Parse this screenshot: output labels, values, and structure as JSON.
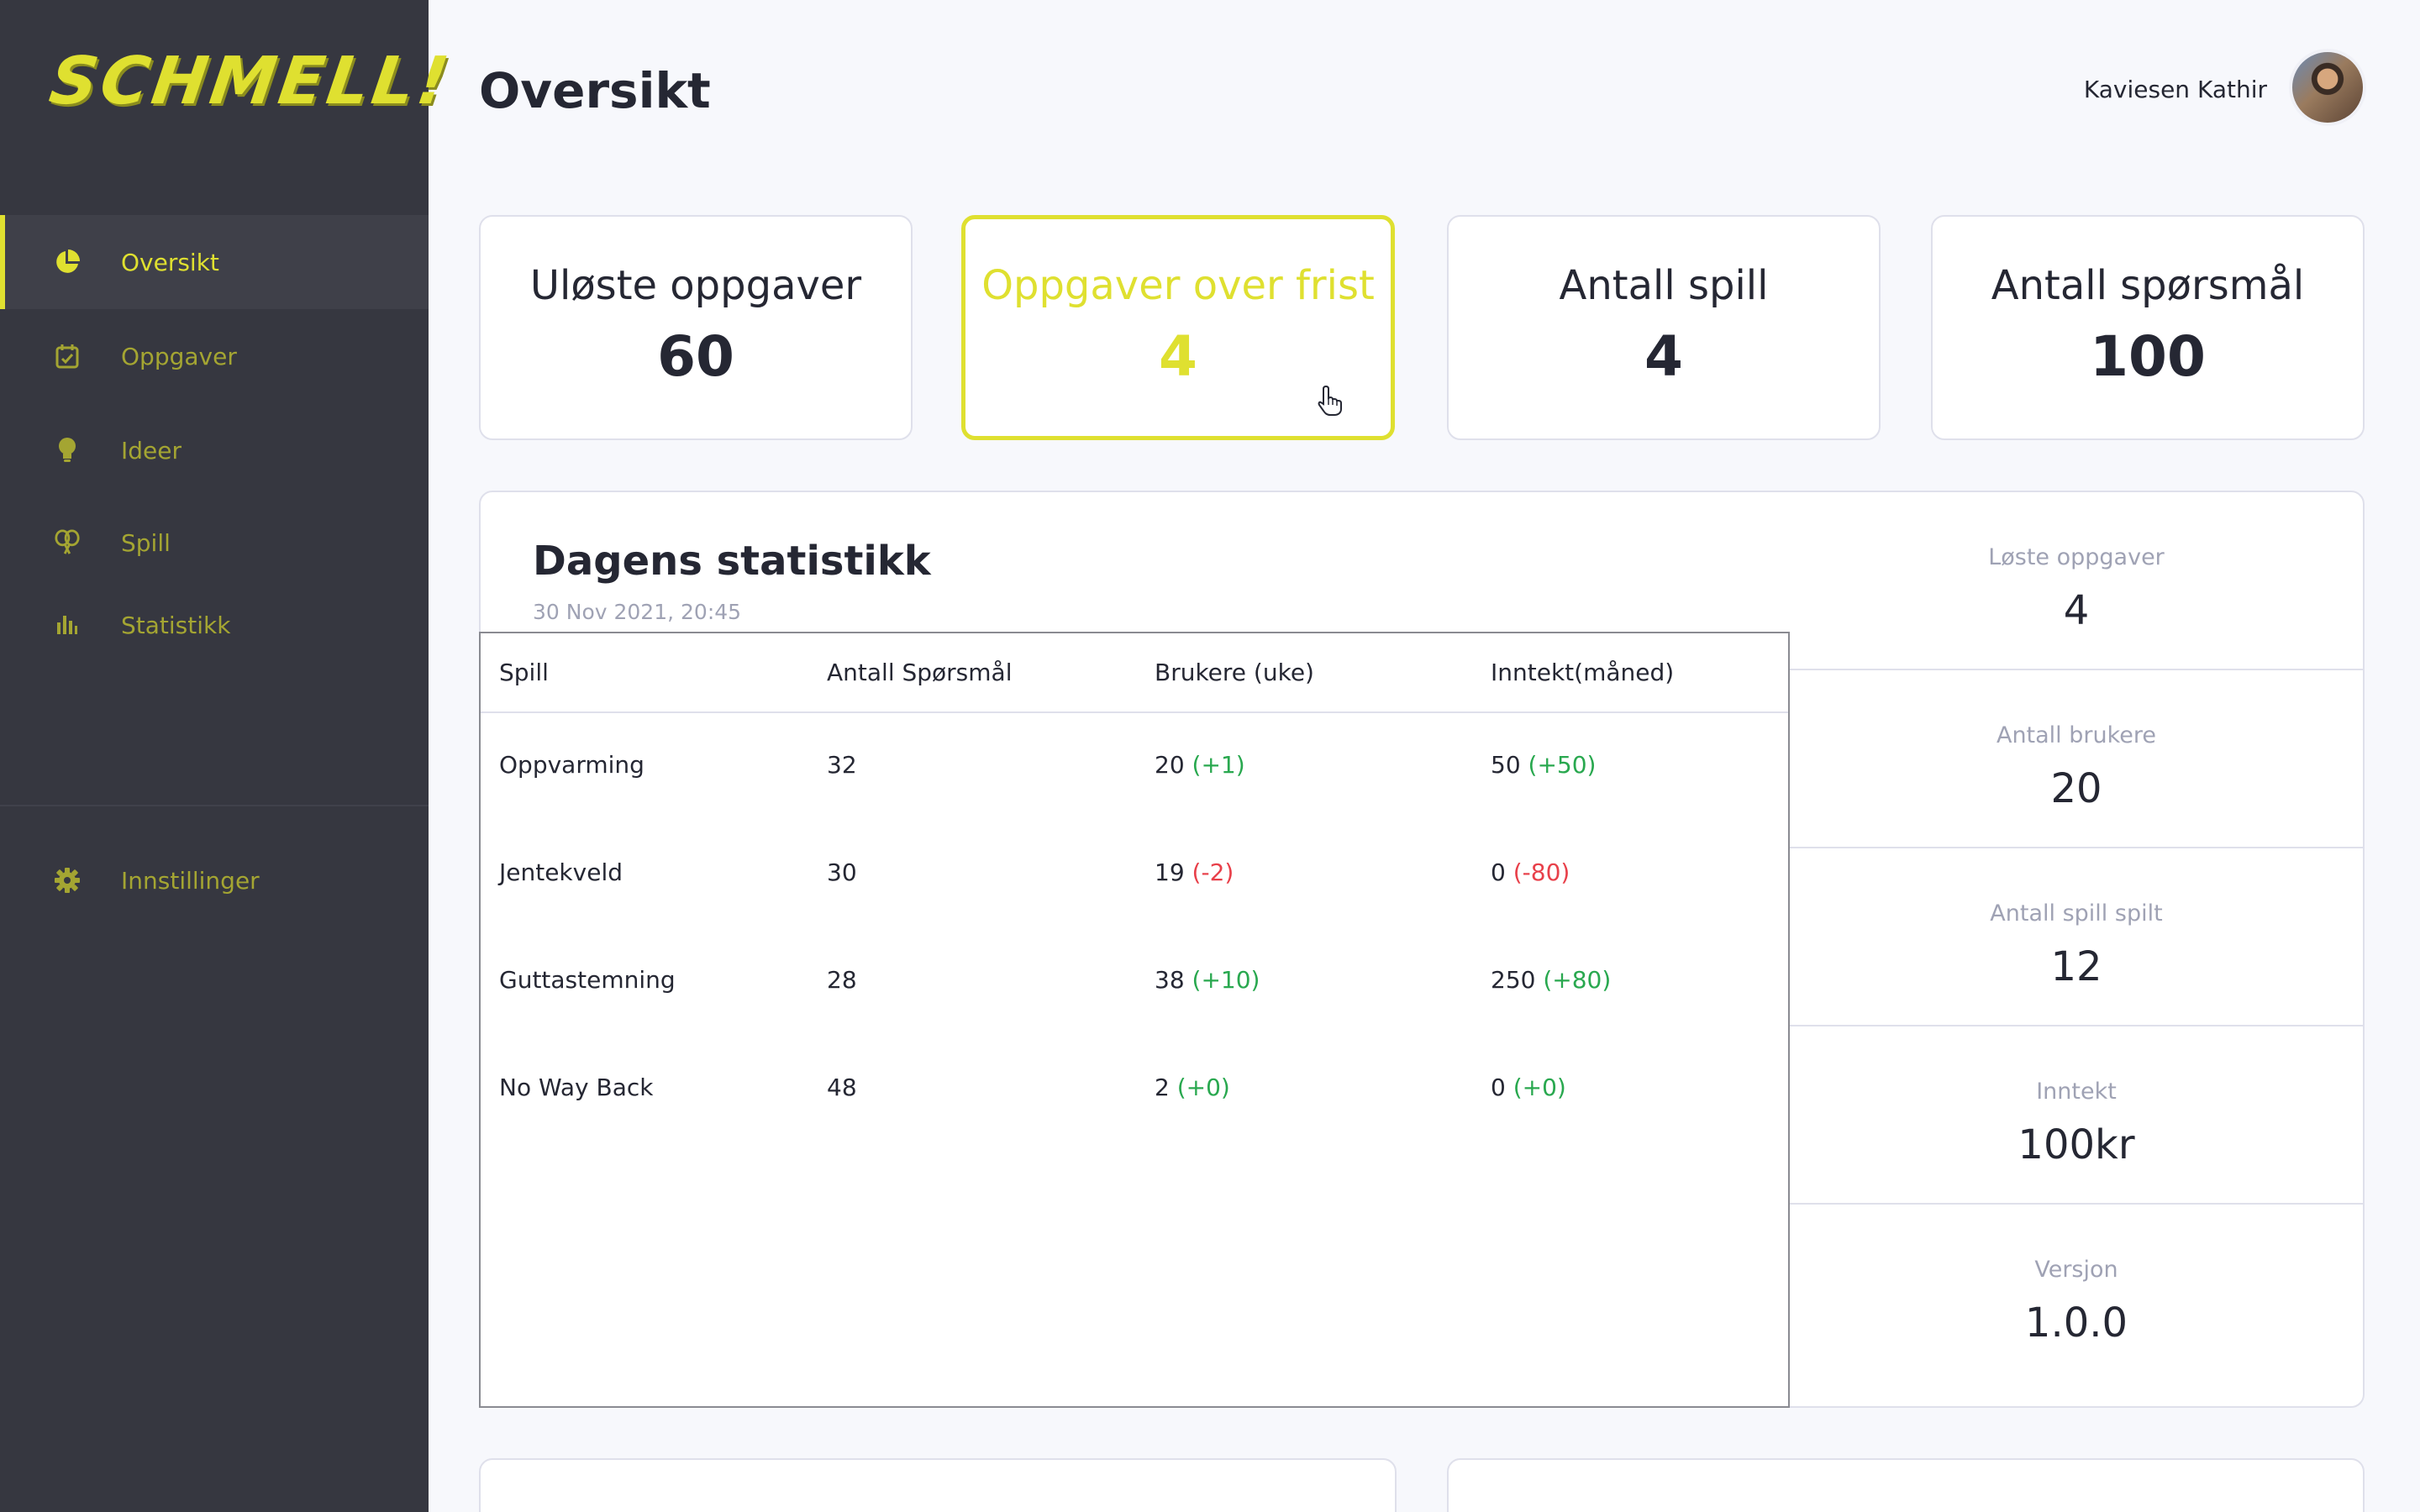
{
  "app": {
    "logo_text": "SCHMELL!"
  },
  "sidebar": {
    "items": [
      {
        "label": "Oversikt",
        "icon": "pie-chart-icon",
        "active": true
      },
      {
        "label": "Oppgaver",
        "icon": "calendar-check-icon"
      },
      {
        "label": "Ideer",
        "icon": "lightbulb-icon"
      },
      {
        "label": "Spill",
        "icon": "rackets-icon"
      },
      {
        "label": "Statistikk",
        "icon": "bar-chart-icon"
      }
    ],
    "settings": {
      "label": "Innstillinger",
      "icon": "gear-icon"
    }
  },
  "header": {
    "title": "Oversikt",
    "user_name": "Kaviesen Kathir"
  },
  "kpis": [
    {
      "label": "Uløste oppgaver",
      "value": "60"
    },
    {
      "label": "Oppgaver over frist",
      "value": "4",
      "highlight": true
    },
    {
      "label": "Antall spill",
      "value": "4"
    },
    {
      "label": "Antall spørsmål",
      "value": "100"
    }
  ],
  "stats": {
    "title": "Dagens statistikk",
    "date": "30 Nov 2021, 20:45",
    "table": {
      "headers": [
        "Spill",
        "Antall Spørsmål",
        "Brukere (uke)",
        "Inntekt(måned)"
      ],
      "rows": [
        {
          "game": "Oppvarming",
          "questions": "32",
          "users": "20",
          "users_delta": "(+1)",
          "income": "50",
          "income_delta": "(+50)"
        },
        {
          "game": "Jentekveld",
          "questions": "30",
          "users": "19",
          "users_delta": "(-2)",
          "income": "0",
          "income_delta": "(-80)"
        },
        {
          "game": "Guttastemning",
          "questions": "28",
          "users": "38",
          "users_delta": "(+10)",
          "income": "250",
          "income_delta": "(+80)"
        },
        {
          "game": "No Way Back",
          "questions": "48",
          "users": "2",
          "users_delta": "(+0)",
          "income": "0",
          "income_delta": "(+0)"
        }
      ]
    },
    "side": [
      {
        "label": "Løste oppgaver",
        "value": "4"
      },
      {
        "label": "Antall brukere",
        "value": "20"
      },
      {
        "label": "Antall spill spilt",
        "value": "12"
      },
      {
        "label": "Inntekt",
        "value": "100kr"
      },
      {
        "label": "Versjon",
        "value": "1.0.0"
      }
    ]
  },
  "colors": {
    "accent": "#dfe030",
    "sidebar_bg": "#363740",
    "positive": "#29a84f",
    "negative": "#e8404a"
  }
}
